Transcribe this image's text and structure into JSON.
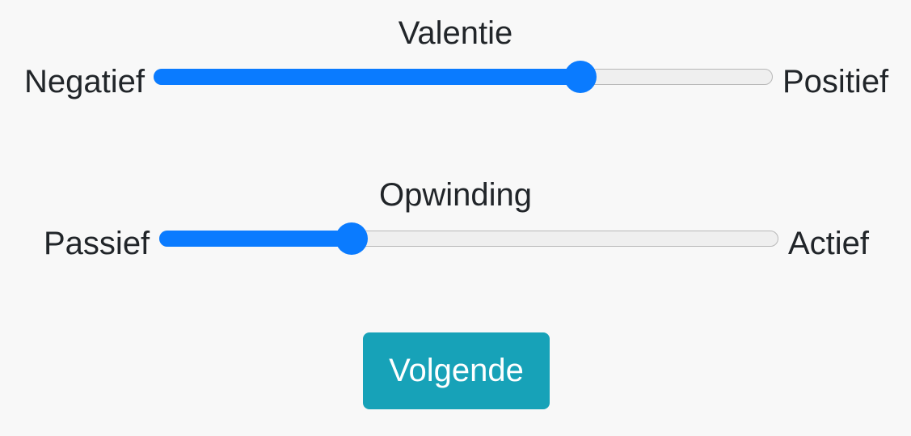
{
  "valence": {
    "title": "Valentie",
    "min_label": "Negatief",
    "max_label": "Positief",
    "value_fraction": 0.69
  },
  "arousal": {
    "title": "Opwinding",
    "min_label": "Passief",
    "max_label": "Actief",
    "value_fraction": 0.31
  },
  "next_button": {
    "label": "Volgende"
  },
  "colors": {
    "slider_accent": "#0a7bff",
    "button_background": "#17a2b8",
    "page_background": "#f8f8f8"
  }
}
